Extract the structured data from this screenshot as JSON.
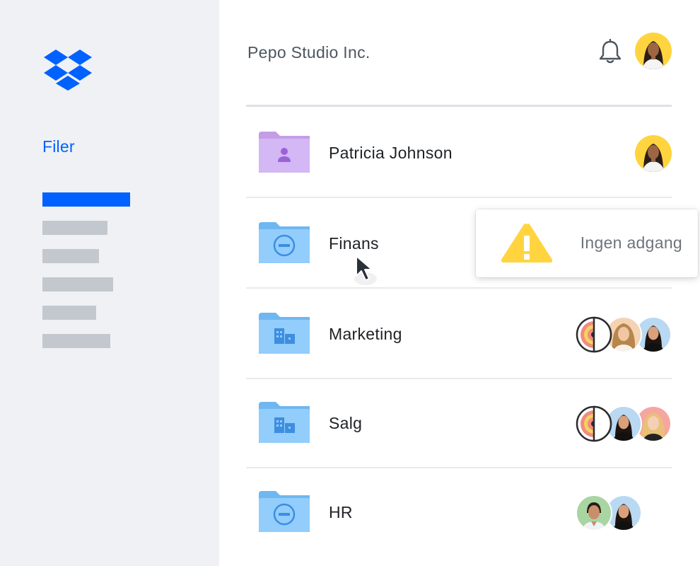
{
  "sidebar": {
    "logo_icon": "dropbox-logo",
    "nav_label": "Filer",
    "colors": {
      "accent": "#0061fe",
      "placeholder": "#c3c8cf",
      "background": "#eff1f5"
    }
  },
  "header": {
    "title": "Pepo Studio Inc.",
    "notification_icon": "bell-icon",
    "avatar": "user-avatar"
  },
  "folders": [
    {
      "name": "Patricia Johnson",
      "type": "personal",
      "color": "#d4b7f5",
      "members": [
        "yellow-person"
      ]
    },
    {
      "name": "Finans",
      "type": "restricted",
      "color": "#92cdfc",
      "members": [],
      "tooltip": "Ingen adgang",
      "tooltip_icon": "warning-icon"
    },
    {
      "name": "Marketing",
      "type": "team",
      "color": "#92cdfc",
      "members": [
        "team-logo",
        "woman-peach",
        "woman-blue"
      ]
    },
    {
      "name": "Salg",
      "type": "team",
      "color": "#92cdfc",
      "members": [
        "team-logo",
        "woman-blue",
        "woman-pink"
      ]
    },
    {
      "name": "HR",
      "type": "restricted",
      "color": "#92cdfc",
      "members": [
        "man-green",
        "woman-blue"
      ]
    }
  ]
}
